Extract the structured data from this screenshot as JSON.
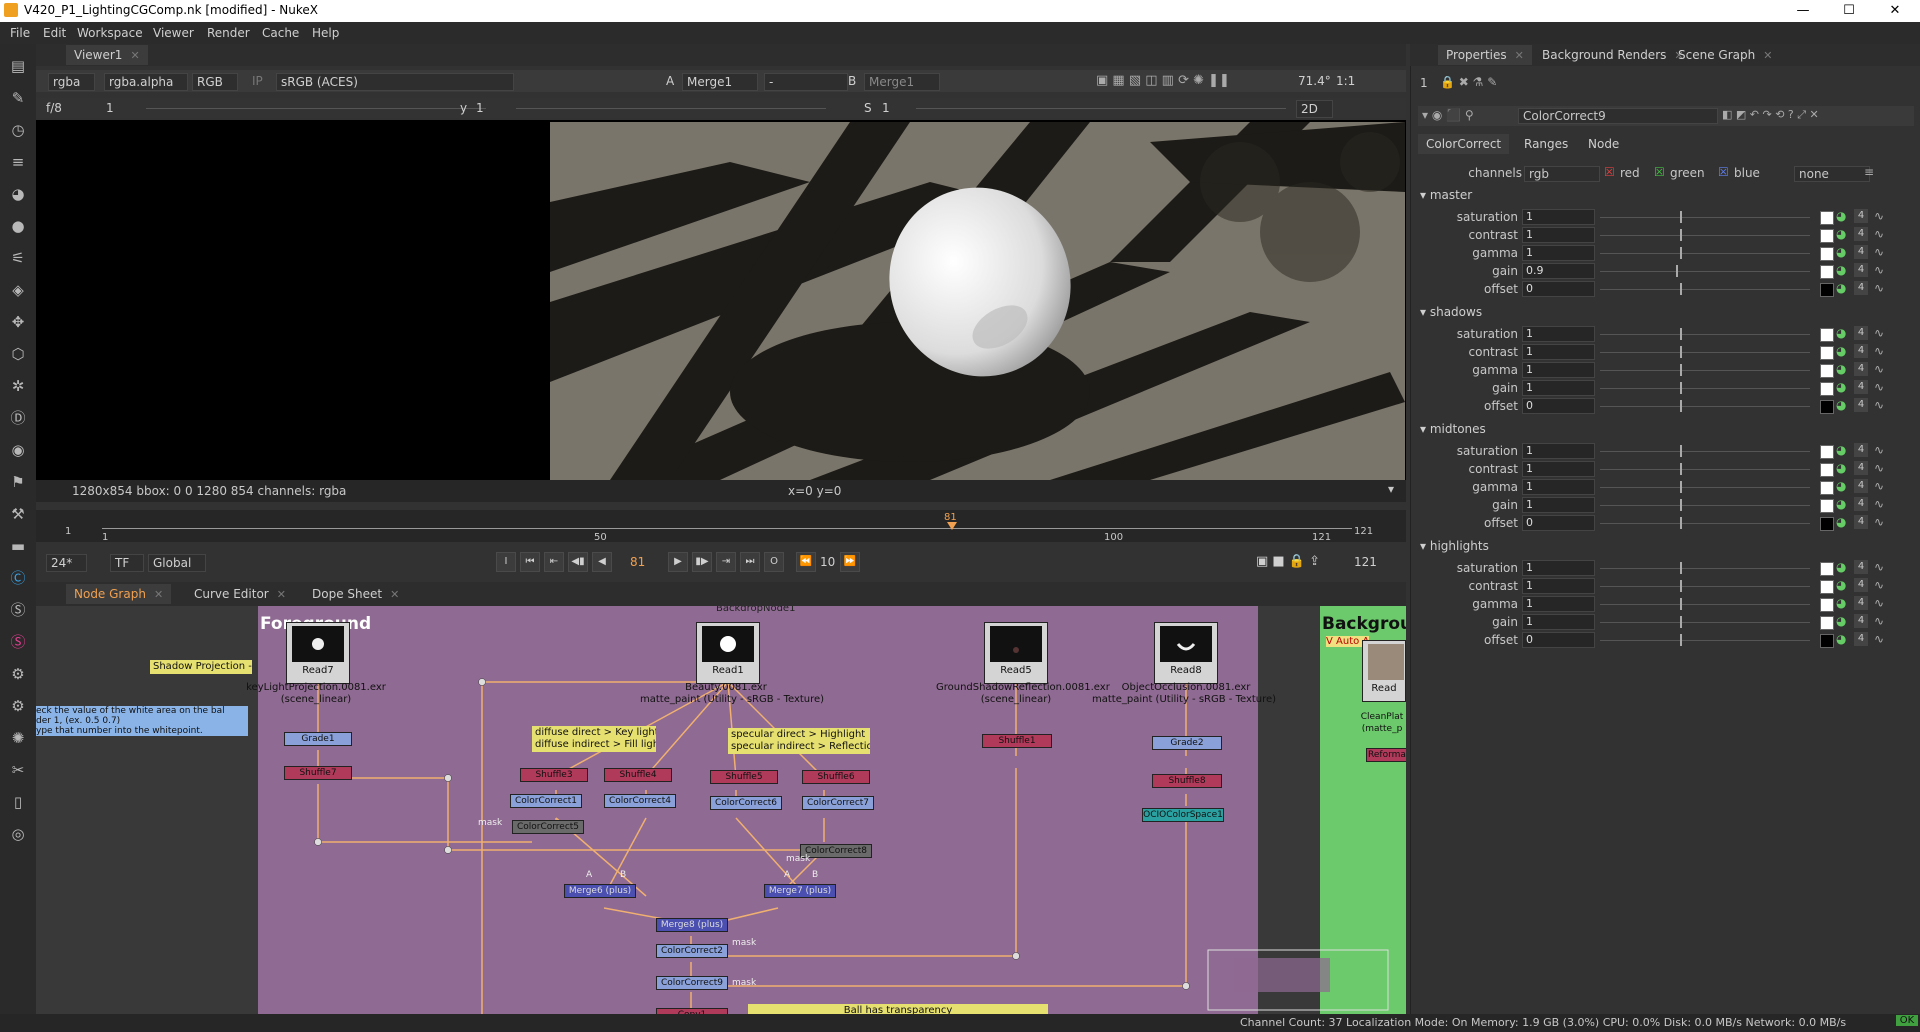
{
  "window": {
    "title": "V420_P1_LightingCGComp.nk [modified] - NukeX",
    "controls": {
      "minimize": "—",
      "maximize": "☐",
      "close": "✕"
    }
  },
  "menu": [
    "File",
    "Edit",
    "Workspace",
    "Viewer",
    "Render",
    "Cache",
    "Help"
  ],
  "viewer": {
    "tab": "Viewer1",
    "channels": "rgba",
    "alpha": "rgba.alpha",
    "display": "RGB",
    "ip": "IP",
    "colorspace": "sRGB (ACES)",
    "input_a_label": "A",
    "input_a": "Merge1",
    "input_a_op": "-",
    "input_b_label": "B",
    "input_b": "Merge1",
    "zoom": "71.4°",
    "ratio": "1:1",
    "fstop": "f/8",
    "frame_field": "1",
    "y_label": "y",
    "y_value": "1",
    "s_label": "S",
    "s_value": "1",
    "mode": "2D",
    "info": "1280x854  bbox: 0 0 1280 854 channels: rgba",
    "coords": "x=0 y=0"
  },
  "timeline": {
    "start": "1",
    "end": "121",
    "in": "1",
    "out": "121",
    "tick_50": "50",
    "tick_100": "100",
    "current": "81",
    "fps": "24*",
    "tf": "TF",
    "global": "Global",
    "frame_display": "81",
    "step": "10",
    "end_display": "121"
  },
  "graph_tabs": [
    {
      "label": "Node Graph",
      "active": true
    },
    {
      "label": "Curve Editor",
      "active": false
    },
    {
      "label": "Dope Sheet",
      "active": false
    }
  ],
  "node_graph": {
    "backdrop_top_label": "BackdropNode1",
    "backdrop_fg": "Foreground",
    "backdrop_bg": "Backgrou",
    "auto_label": "V Auto A",
    "sticky_shadow": "Shadow Projection -",
    "sticky_note_lines": [
      "eck the value of the white area on the bal",
      "der 1, (ex. 0.5 0.7)",
      "ype that number into the whitepoint."
    ],
    "sticky_diffuse": [
      "diffuse direct > Key light",
      "diffuse indirect > Fill light"
    ],
    "sticky_specular": [
      "specular direct > Highlight",
      "specular indirect > Reflection"
    ],
    "sticky_ball": "Ball has transparency",
    "reads": [
      {
        "name": "Read7",
        "file": "keyLightProjection.0081.exr",
        "cs": "(scene_linear)"
      },
      {
        "name": "Read1",
        "file": "Beauty.0081.exr",
        "cs": "matte_paint (Utility - sRGB - Texture)"
      },
      {
        "name": "Read5",
        "file": "GroundShadowReflection.0081.exr",
        "cs": "(scene_linear)"
      },
      {
        "name": "Read8",
        "file": "ObjectOcclusion.0081.exr",
        "cs": "matte_paint (Utility - sRGB - Texture)"
      },
      {
        "name": "Read",
        "file": "CleanPlat",
        "cs": "(matte_p"
      }
    ],
    "nodes": {
      "grade1": "Grade1",
      "shuffle7": "Shuffle7",
      "shuffle3": "Shuffle3",
      "shuffle4": "Shuffle4",
      "shuffle5": "Shuffle5",
      "shuffle6": "Shuffle6",
      "cc1": "ColorCorrect1",
      "cc4": "ColorCorrect4",
      "cc6": "ColorCorrect6",
      "cc7": "ColorCorrect7",
      "cc5": "ColorCorrect5",
      "cc8": "ColorCorrect8",
      "merge6": "Merge6 (plus)",
      "merge7": "Merge7 (plus)",
      "merge8": "Merge8 (plus)",
      "cc2": "ColorCorrect2",
      "cc9": "ColorCorrect9",
      "copy1": "Copy1",
      "shuffle1": "Shuffle1",
      "grade2": "Grade2",
      "shuffle8": "Shuffle8",
      "ocio": "OCIOColorSpace1",
      "reformat": "Reforma"
    },
    "edge_labels": {
      "mask": "mask",
      "a": "A",
      "b": "B"
    }
  },
  "properties": {
    "tabs": [
      "Properties",
      "Background Renders",
      "Scene Graph"
    ],
    "count": "1",
    "node_name": "ColorCorrect9",
    "node_tabs": [
      "ColorCorrect",
      "Ranges",
      "Node"
    ],
    "channels_label": "channels",
    "channels_value": "rgb",
    "ch_red": "red",
    "ch_green": "green",
    "ch_blue": "blue",
    "ch_none": "none",
    "groups": [
      {
        "name": "master",
        "rows": [
          {
            "label": "saturation",
            "value": "1"
          },
          {
            "label": "contrast",
            "value": "1"
          },
          {
            "label": "gamma",
            "value": "1"
          },
          {
            "label": "gain",
            "value": "0.9"
          },
          {
            "label": "offset",
            "value": "0"
          }
        ]
      },
      {
        "name": "shadows",
        "rows": [
          {
            "label": "saturation",
            "value": "1"
          },
          {
            "label": "contrast",
            "value": "1"
          },
          {
            "label": "gamma",
            "value": "1"
          },
          {
            "label": "gain",
            "value": "1"
          },
          {
            "label": "offset",
            "value": "0"
          }
        ]
      },
      {
        "name": "midtones",
        "rows": [
          {
            "label": "saturation",
            "value": "1"
          },
          {
            "label": "contrast",
            "value": "1"
          },
          {
            "label": "gamma",
            "value": "1"
          },
          {
            "label": "gain",
            "value": "1"
          },
          {
            "label": "offset",
            "value": "0"
          }
        ]
      },
      {
        "name": "highlights",
        "rows": [
          {
            "label": "saturation",
            "value": "1"
          },
          {
            "label": "contrast",
            "value": "1"
          },
          {
            "label": "gamma",
            "value": "1"
          },
          {
            "label": "gain",
            "value": "1"
          },
          {
            "label": "offset",
            "value": "0"
          }
        ]
      }
    ],
    "row_count_badge": "4"
  },
  "status": "Channel Count: 37  Localization Mode: On  Memory: 1.9 GB (3.0%)  CPU: 0.0%  Disk: 0.0 MB/s  Network: 0.0 MB/s",
  "status_ok": "OK",
  "colors": {
    "accent": "#f0a050",
    "backdrop_fg": "#8f6a92",
    "backdrop_bg": "#6cc96c"
  }
}
